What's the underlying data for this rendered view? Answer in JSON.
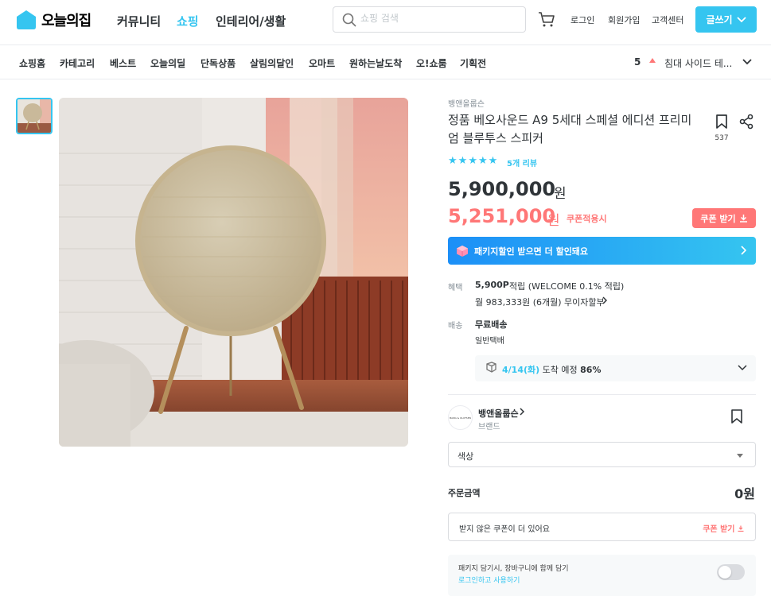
{
  "header": {
    "logo_text": "오늘의집",
    "nav": [
      "커뮤니티",
      "쇼핑",
      "인테리어/생활"
    ],
    "search_placeholder": "쇼핑 검색",
    "links": [
      "로그인",
      "회원가입",
      "고객센터"
    ],
    "write_label": "글쓰기",
    "accent": "#35c5f0"
  },
  "subnav": {
    "items": [
      "쇼핑홈",
      "카테고리",
      "베스트",
      "오늘의딜",
      "단독상품",
      "살림의달인",
      "오마트",
      "원하는날도착",
      "오!쇼룸",
      "기획전"
    ],
    "rank_number": "5",
    "rank_text": "침대 사이드 테..."
  },
  "product": {
    "brand": "뱅앤올룹슨",
    "title": "정품 베오사운드 A9 5세대 스페셜 에디션 프리미엄 블루투스 스피커",
    "bookmark_count": "537",
    "rating_stars": 5,
    "review_label": "5개 리뷰",
    "original_price": "5,900,000",
    "sale_price": "5,251,000",
    "won": "원",
    "coupon_applied": "쿠폰적용시",
    "coupon_button": "쿠폰 받기",
    "package_banner": "패키지할인 받으면 더 할인돼요",
    "benefit_label": "혜택",
    "benefit_points": "5,900P",
    "benefit_points_suffix": "적립 (WELCOME 0.1% 적립)",
    "installment": "월 983,333원 (6개월) 무이자할부",
    "shipping_label": "배송",
    "shipping_free": "무료배송",
    "shipping_type": "일반택배",
    "arrival_date": "4/14(화)",
    "arrival_text": "도착 예정",
    "arrival_rate": "86%",
    "brand_logo_text": "BANG & OLUFSEN",
    "brand_name": "뱅앤올룹슨",
    "brand_sub": "브랜드",
    "option_select": "색상",
    "order_label": "주문금액",
    "order_value": "0원",
    "coupon_notice": "받지 않은 쿠폰이 더 있어요",
    "coupon_link": "쿠폰 받기",
    "package_toggle_text": "패키지 담기시, 장바구니에 함께 담기",
    "package_login_text": "로그인하고 사용하기",
    "sale_color": "#ff7777"
  }
}
